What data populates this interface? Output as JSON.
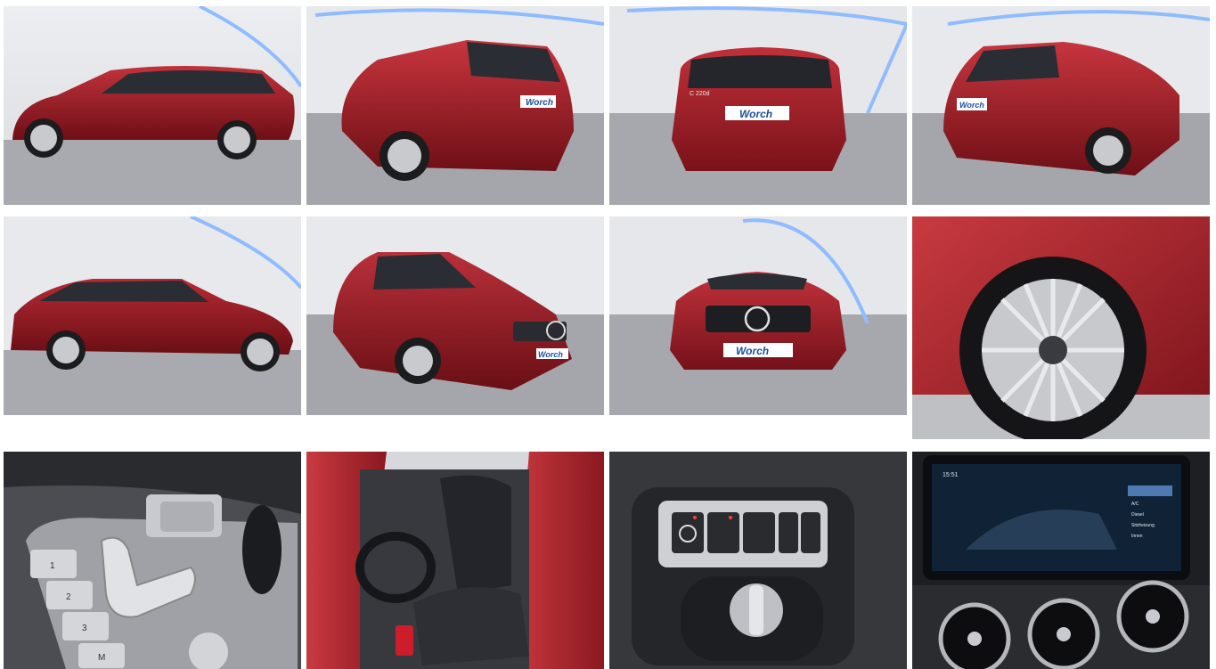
{
  "gallery": {
    "photos": [
      {
        "name": "photo-side-left"
      },
      {
        "name": "photo-rear-three-quarter-left"
      },
      {
        "name": "photo-rear"
      },
      {
        "name": "photo-rear-three-quarter-right"
      },
      {
        "name": "photo-side-right"
      },
      {
        "name": "photo-front-three-quarter-right"
      },
      {
        "name": "photo-front"
      },
      {
        "name": "photo-wheel-detail"
      },
      {
        "name": "photo-seat-controls"
      },
      {
        "name": "photo-driver-seat"
      },
      {
        "name": "photo-light-switch"
      },
      {
        "name": "photo-infotainment"
      }
    ],
    "dealer_plate": "Worch",
    "badge": "C 220d",
    "seat_buttons": [
      "1",
      "2",
      "3",
      "M"
    ],
    "screen_time": "15:51",
    "screen_menu": [
      "A/C",
      "Diesel",
      "Sitzheizung",
      "Innen"
    ],
    "colors": {
      "car_red": "#9c1c25",
      "car_red_light": "#c83a40",
      "studio_floor": "#9a9ca3",
      "studio_wall": "#e6e7ea",
      "led_blue": "#7fb2ff"
    }
  }
}
